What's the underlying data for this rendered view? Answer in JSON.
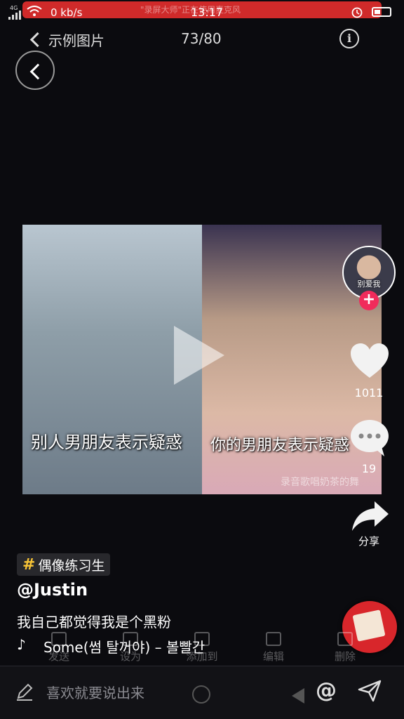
{
  "status_bar": {
    "network_type": "4G",
    "net_speed": "0 kb/s",
    "time": "13:17",
    "recording_banner": "\"录屏大师\"正在使用麦克风",
    "icons": [
      "signal-icon",
      "wifi-icon",
      "alarm-icon",
      "battery-icon"
    ]
  },
  "header": {
    "back_label": "示例图片",
    "counter": "73/80",
    "info_icon": "i"
  },
  "video": {
    "caption_left": "别人男朋友表示疑惑",
    "caption_right": "你的男朋友表示疑惑",
    "watermark": "录音歌唱奶茶的舞"
  },
  "right_rail": {
    "avatar_text": "别爱我",
    "follow": "+",
    "like_count": "1011",
    "comment_count": "19",
    "share_label": "分享"
  },
  "info": {
    "hashtag": "偶像练习生",
    "author": "@Justin",
    "description": "我自己都觉得我是个黑粉",
    "music": "Some(썸 탈꺼야) – 볼빨간"
  },
  "background_actions": [
    "发送",
    "设为",
    "添加到",
    "编辑",
    "删除"
  ],
  "comment_bar": {
    "placeholder": "喜欢就要说出来",
    "at": "@"
  },
  "colors": {
    "background": "#0b0b0f",
    "accent_red": "#f02b5b",
    "hashtag_yellow": "#f7c436",
    "recording_red": "#d02a2a"
  }
}
